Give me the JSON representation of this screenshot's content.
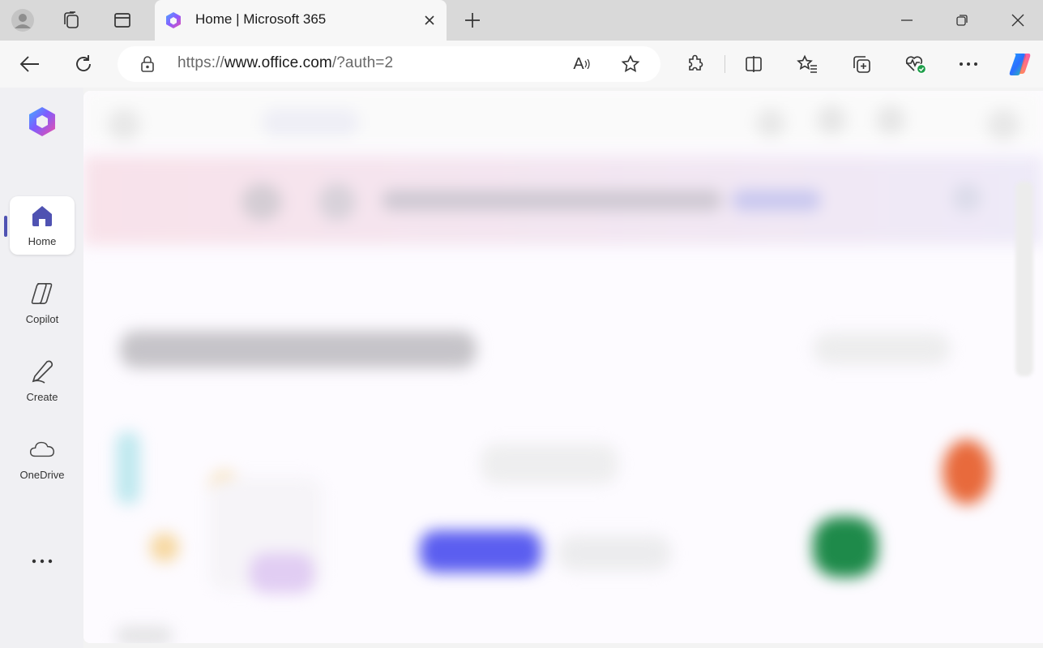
{
  "browser": {
    "tab_title": "Home | Microsoft 365",
    "url_scheme": "https://",
    "url_host": "www.office.com",
    "url_path": "/?auth=2",
    "readaloud_glyph": "A",
    "icons": {
      "profile": "profile-avatar-icon",
      "workspaces": "workspaces-icon",
      "tab_actions": "vertical-tabs-icon",
      "back": "back-arrow-icon",
      "refresh": "refresh-icon",
      "lock": "lock-icon",
      "favorite": "star-icon",
      "extensions": "puzzle-icon",
      "split_screen": "split-screen-icon",
      "favorites": "favorites-list-icon",
      "collections": "collections-icon",
      "browser_essentials": "heart-pulse-icon",
      "more": "more-dots-icon",
      "copilot": "copilot-icon"
    }
  },
  "m365_nav": {
    "items": [
      {
        "label": "Home",
        "icon": "home-icon",
        "active": true
      },
      {
        "label": "Copilot",
        "icon": "copilot-icon",
        "active": false
      },
      {
        "label": "Create",
        "icon": "pencil-icon",
        "active": false
      },
      {
        "label": "OneDrive",
        "icon": "cloud-icon",
        "active": false
      }
    ],
    "more_icon": "more-dots-icon"
  },
  "colors": {
    "accent": "#4f52b2",
    "home_icon": "#4f52b2",
    "banner": "#f7e4ee",
    "primary_button": "#5b5ef0",
    "excel_green": "#1e8a4a",
    "orange": "#e86a3c"
  }
}
